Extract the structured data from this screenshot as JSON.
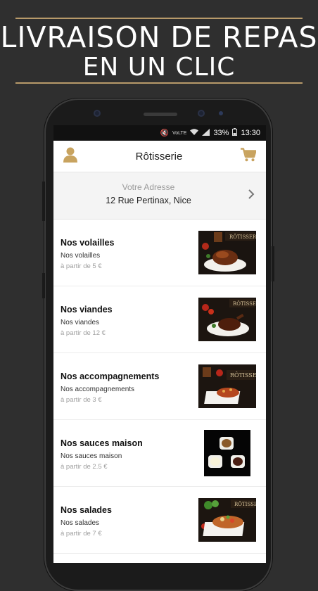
{
  "banner": {
    "line1": "LIVRAISON DE REPAS",
    "line2": "EN UN CLIC"
  },
  "status_bar": {
    "network": "VoLTE",
    "battery": "33%",
    "time": "13:30"
  },
  "header": {
    "title": "Rôtisserie",
    "left_icon": "user-icon",
    "right_icon": "cart-icon"
  },
  "address": {
    "placeholder": "Votre Adresse",
    "value": "12 Rue Pertinax, Nice"
  },
  "categories": [
    {
      "title": "Nos volailles",
      "subtitle": "Nos volailles",
      "price": "à partir de 5 €"
    },
    {
      "title": "Nos viandes",
      "subtitle": "Nos viandes",
      "price": "à partir de 12 €"
    },
    {
      "title": "Nos accompagnements",
      "subtitle": "Nos accompagnements",
      "price": "à partir de 3 €"
    },
    {
      "title": "Nos sauces maison",
      "subtitle": "Nos sauces maison",
      "price": "à partir de 2.5 €"
    },
    {
      "title": "Nos salades",
      "subtitle": "Nos salades",
      "price": "à partir de 7 €"
    }
  ],
  "colors": {
    "accent": "#c8a35f",
    "background": "#2f2f2f",
    "banner_line": "#b89a6a"
  }
}
